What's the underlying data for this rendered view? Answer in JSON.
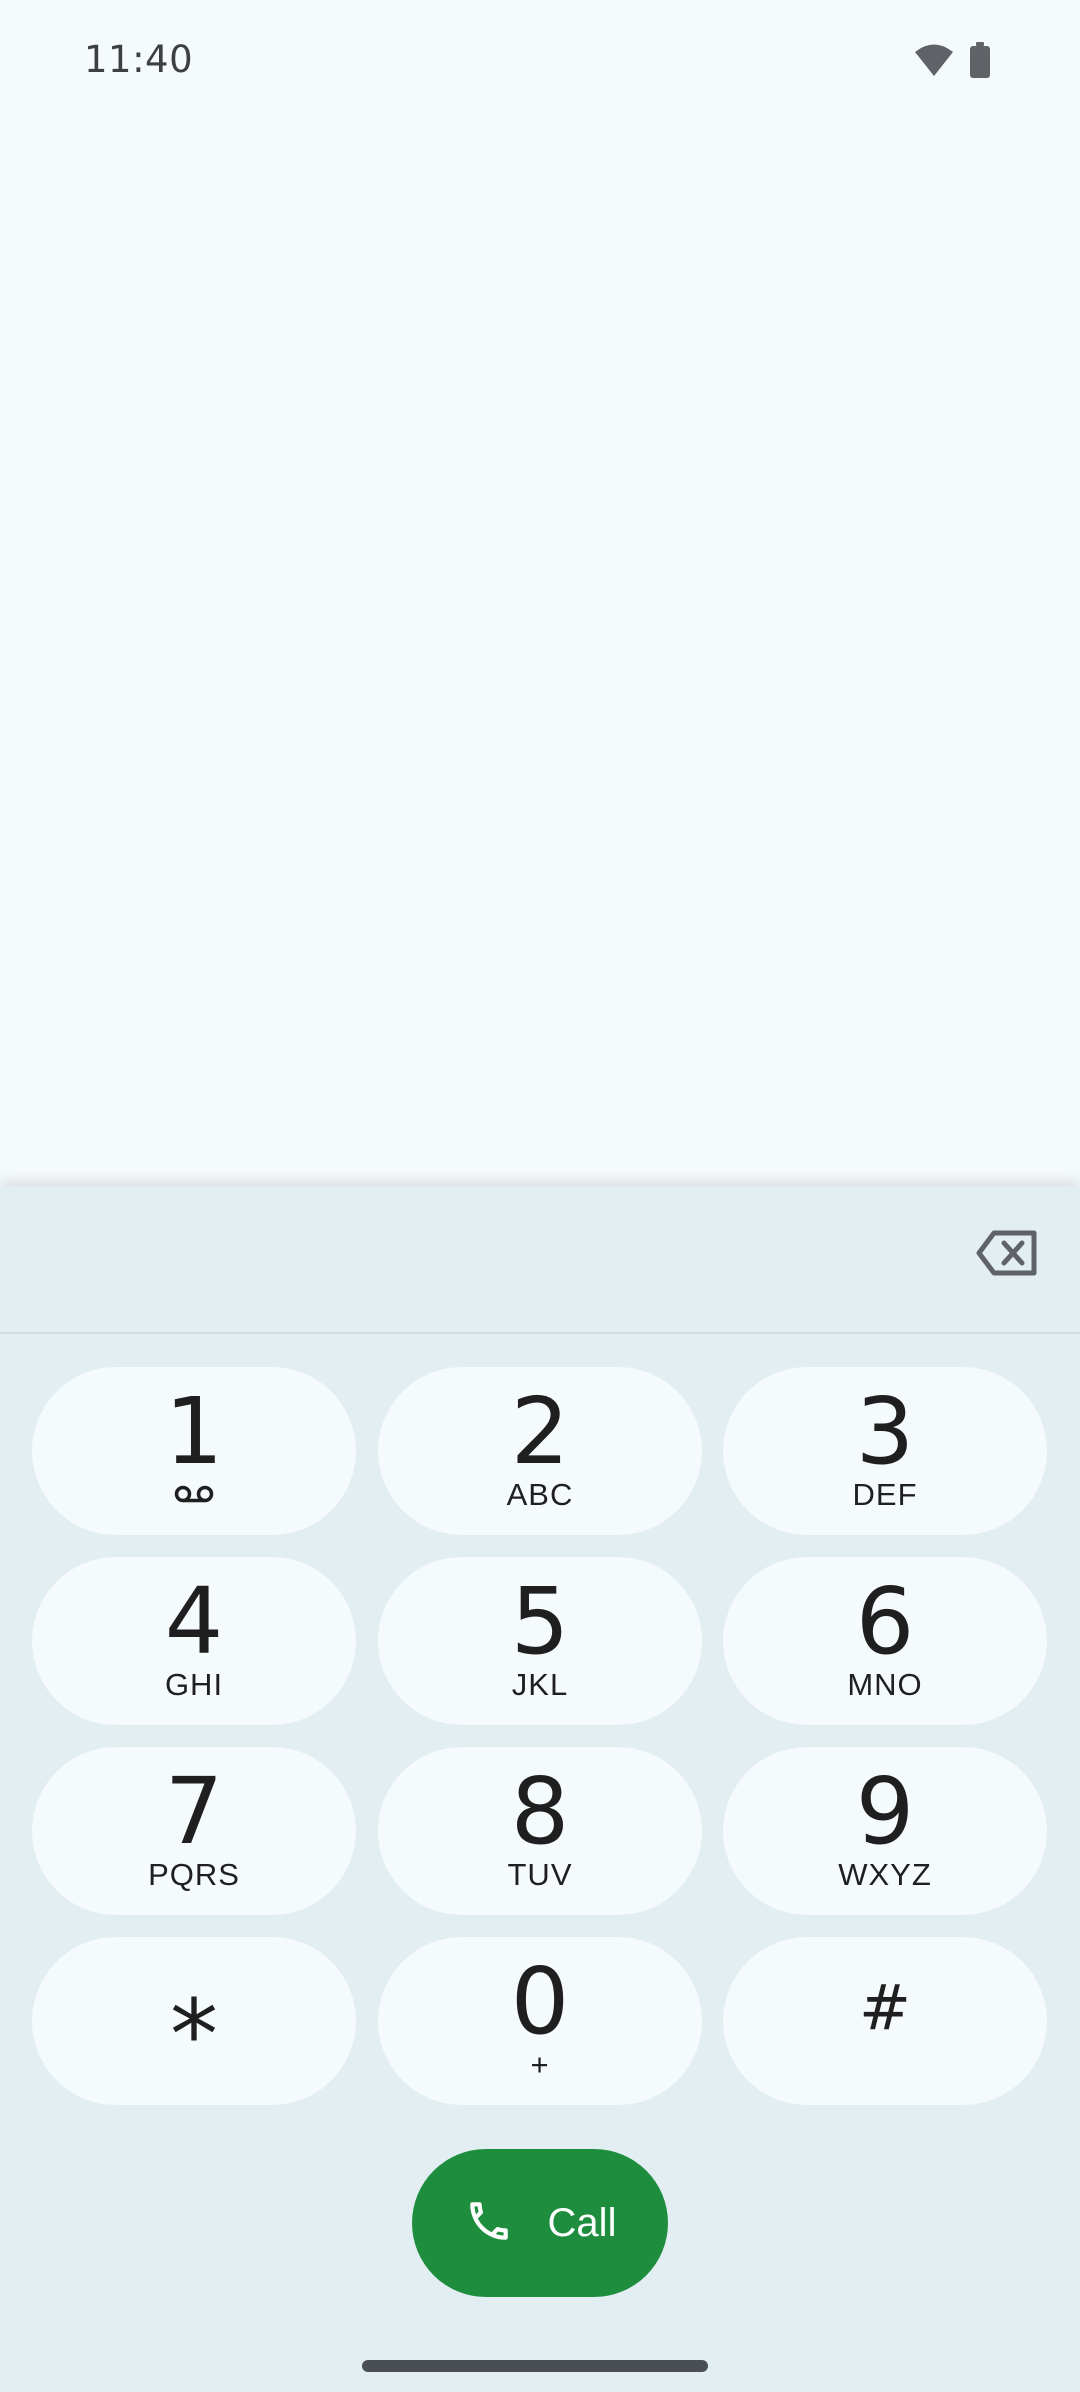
{
  "status_bar": {
    "time": "11:40",
    "wifi_icon": "wifi-icon",
    "battery_icon": "battery-icon"
  },
  "dialpad": {
    "digits_value": "",
    "backspace_icon": "backspace-icon",
    "keys": [
      {
        "digit": "1",
        "letters": "",
        "icon": "voicemail-icon"
      },
      {
        "digit": "2",
        "letters": "ABC"
      },
      {
        "digit": "3",
        "letters": "DEF"
      },
      {
        "digit": "4",
        "letters": "GHI"
      },
      {
        "digit": "5",
        "letters": "JKL"
      },
      {
        "digit": "6",
        "letters": "MNO"
      },
      {
        "digit": "7",
        "letters": "PQRS"
      },
      {
        "digit": "8",
        "letters": "TUV"
      },
      {
        "digit": "9",
        "letters": "WXYZ"
      },
      {
        "digit": "*",
        "letters": ""
      },
      {
        "digit": "0",
        "letters": "+"
      },
      {
        "digit": "#",
        "letters": ""
      }
    ]
  },
  "call_button": {
    "label": "Call",
    "icon": "phone-icon"
  },
  "colors": {
    "background": "#F5FAFD",
    "dialpad_sheet": "#E2EEF1",
    "call_green": "#1E8E3E",
    "text": "#1F1F1F"
  }
}
